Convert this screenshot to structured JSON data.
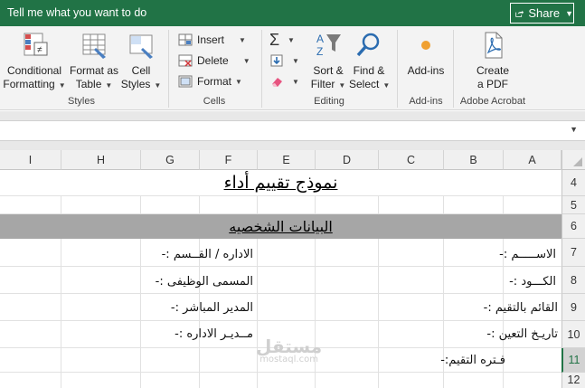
{
  "tell_me": "Tell me what you want to do",
  "share": {
    "label": "Share"
  },
  "ribbon": {
    "styles": {
      "conditional_formatting": {
        "line1": "Conditional",
        "line2": "Formatting"
      },
      "format_as_table": {
        "line1": "Format as",
        "line2": "Table"
      },
      "cell_styles": {
        "line1": "Cell",
        "line2": "Styles"
      },
      "group_label": "Styles"
    },
    "cells": {
      "insert": "Insert",
      "delete": "Delete",
      "format": "Format",
      "group_label": "Cells"
    },
    "editing": {
      "sort_filter": {
        "line1": "Sort &",
        "line2": "Filter"
      },
      "find_select": {
        "line1": "Find &",
        "line2": "Select"
      },
      "group_label": "Editing"
    },
    "addins": {
      "addins": "Add-ins",
      "group_label": "Add-ins"
    },
    "adobe": {
      "create_pdf": {
        "line1": "Create",
        "line2": "a PDF"
      },
      "group_label": "Adobe Acrobat"
    }
  },
  "columns": [
    "I",
    "H",
    "G",
    "F",
    "E",
    "D",
    "C",
    "B",
    "A"
  ],
  "rows": [
    "4",
    "5",
    "6",
    "7",
    "8",
    "9",
    "10",
    "11",
    "12"
  ],
  "sheet": {
    "title": "نموذج تقييم أداء",
    "section_header": "البيانات الشخصيه",
    "right_labels": [
      "الاســـــم :-",
      "الكـــود :-",
      "القائم  بالتقيم :-",
      "تاريـخ  التعين :-",
      "فـتره  التقيم:-"
    ],
    "left_labels": [
      "الاداره   /   القــسم  :-",
      "المسمى   الوظيفى  :-",
      "المدير   المباشر  :-",
      "مــديـر   الاداره  :-"
    ]
  },
  "watermark": {
    "line1": "مستقل",
    "line2": "mostaql.com"
  }
}
